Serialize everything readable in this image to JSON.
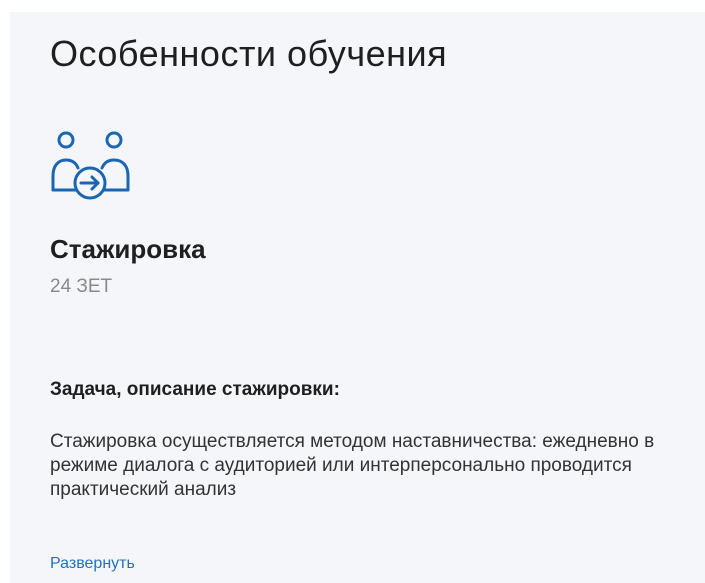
{
  "section": {
    "title": "Особенности обучения"
  },
  "feature": {
    "icon": "people-transfer-icon",
    "name": "Стажировка",
    "credits": "24 ЗЕТ"
  },
  "task": {
    "heading": "Задача, описание стажировки:",
    "description": "Стажировка осуществляется методом наставничества: ежедневно в режиме диалога с аудиторией или интерперсонально проводится практический анализ"
  },
  "actions": {
    "expand_label": "Развернуть"
  },
  "colors": {
    "card_background": "#f5f6f9",
    "icon_stroke": "#1a66b3",
    "link": "#1a73c8",
    "muted_text": "#8a8a8a"
  }
}
